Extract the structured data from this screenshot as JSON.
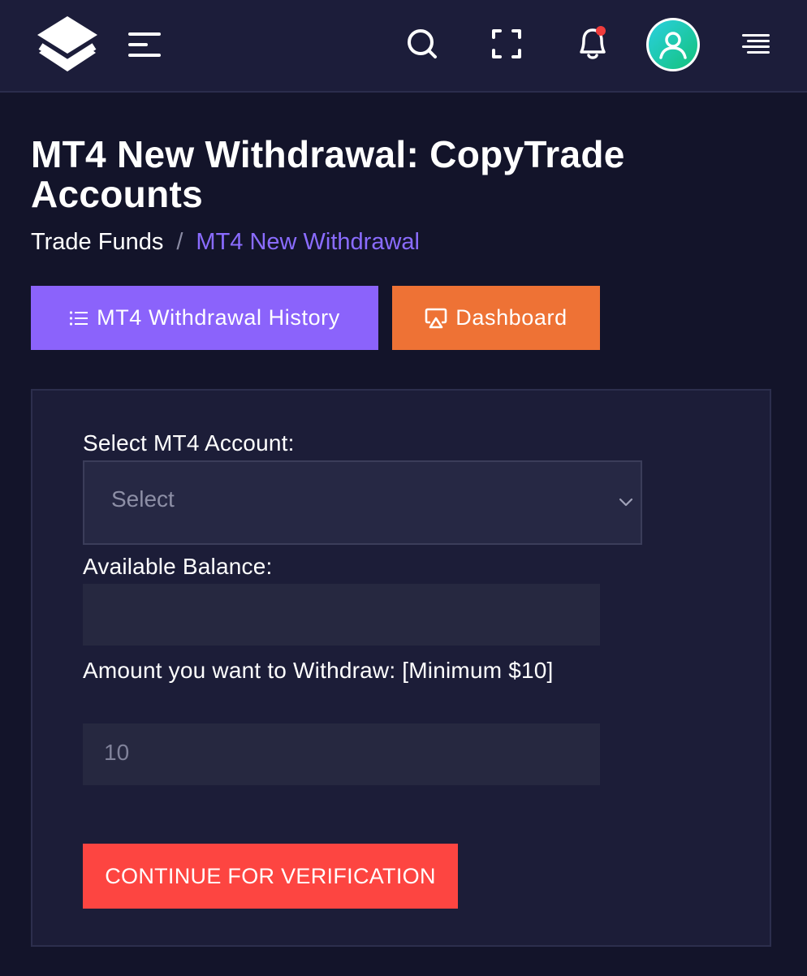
{
  "header": {
    "logo_icon": "layers-logo-icon",
    "menu_icon": "hamburger-icon",
    "search_icon": "search-icon",
    "fullscreen_icon": "fullscreen-icon",
    "notification_icon": "bell-icon",
    "notification_dot_color": "#f03c3c",
    "avatar_icon": "user-avatar-icon",
    "right_menu_icon": "align-right-menu-icon"
  },
  "page": {
    "title": "MT4 New Withdrawal: CopyTrade Accounts",
    "breadcrumb": {
      "parent": "Trade Funds",
      "separator": "/",
      "current": "MT4 New Withdrawal"
    }
  },
  "actions": {
    "history_label": "MT4 Withdrawal History",
    "history_icon": "list-icon",
    "history_color": "#8b63fb",
    "dashboard_label": "Dashboard",
    "dashboard_icon": "airplay-icon",
    "dashboard_color": "#ee7235"
  },
  "form": {
    "account_label": "Select MT4 Account:",
    "account_select_value": "Select",
    "balance_label": "Available Balance:",
    "balance_value": "",
    "amount_label": "Amount you want to Withdraw: [Minimum $10]",
    "amount_placeholder": "10",
    "submit_label": "CONTINUE FOR VERIFICATION",
    "submit_color": "#fd4541"
  }
}
